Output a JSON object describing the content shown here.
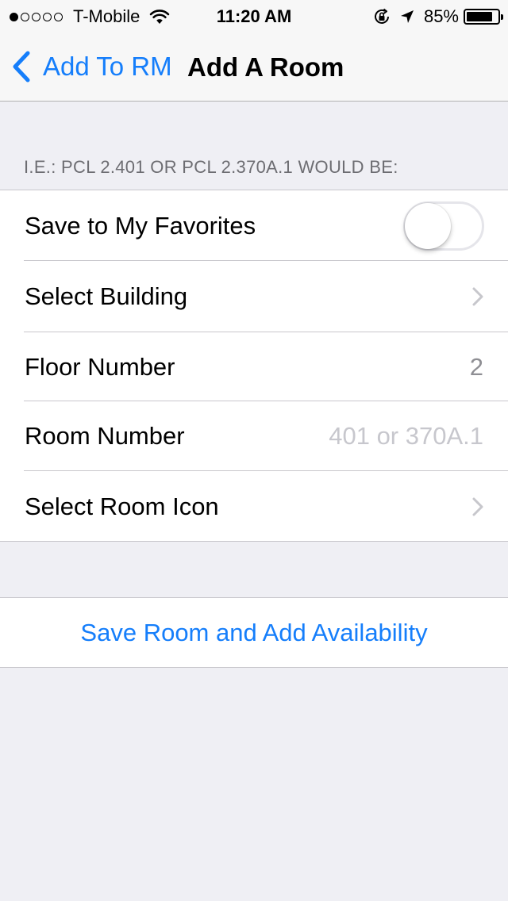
{
  "status_bar": {
    "signal_bars_filled": 1,
    "signal_bars_total": 5,
    "carrier": "T-Mobile",
    "time": "11:20 AM",
    "battery_percent": "85%",
    "battery_level": 0.85
  },
  "nav": {
    "back_label": "Add To RM",
    "title": "Add A Room"
  },
  "section": {
    "header": "I.E.: PCL 2.401 OR PCL 2.370A.1 WOULD BE:"
  },
  "cells": {
    "favorites": {
      "label": "Save to My Favorites",
      "toggle_on": false
    },
    "building": {
      "label": "Select Building"
    },
    "floor": {
      "label": "Floor Number",
      "value": "2"
    },
    "room": {
      "label": "Room Number",
      "placeholder": "401 or 370A.1"
    },
    "icon": {
      "label": "Select Room Icon"
    }
  },
  "action": {
    "label": "Save Room and Add Availability"
  },
  "colors": {
    "tint": "#157efb",
    "background": "#efeff4"
  }
}
